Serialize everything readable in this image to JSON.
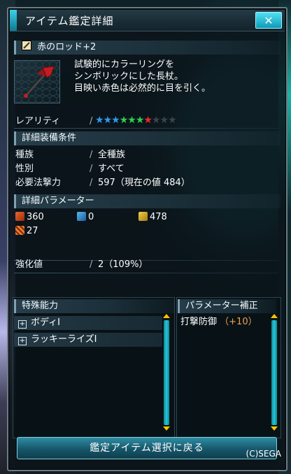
{
  "window": {
    "title": "アイテム鑑定詳細",
    "close_label": "✕"
  },
  "item": {
    "name": "赤のロッド+2",
    "description": "試験的にカラーリングを\nシンボリックにした長杖。\n目映い赤色は必然的に目を引く。"
  },
  "rarity": {
    "label": "レアリティ",
    "max": 10,
    "value": 7
  },
  "requirements": {
    "heading": "詳細装備条件",
    "race_label": "種族",
    "race_value": "全種族",
    "gender_label": "性別",
    "gender_value": "すべて",
    "power_label": "必要法撃力",
    "power_value": "597（現在の値 484）"
  },
  "parameters": {
    "heading": "詳細パラメーター",
    "strike_value": "360",
    "range_value": "0",
    "tech_value": "478",
    "special_value": "27"
  },
  "enhance": {
    "label": "強化値",
    "value": "2（109%）"
  },
  "special_abilities": {
    "heading": "特殊能力",
    "items": [
      {
        "label": "ボディⅠ"
      },
      {
        "label": "ラッキーライズⅠ"
      }
    ]
  },
  "param_correction": {
    "heading": "パラメーター補正",
    "label": "打撃防御",
    "value": "（+10）"
  },
  "footer": {
    "back_button": "鑑定アイテム選択に戻る",
    "copyright": "(C)SEGA"
  },
  "colors": {
    "accent": "#24c6d6",
    "bonus": "#f0a050",
    "scroll_arrow": "#f5c400"
  },
  "icons": {
    "close": "close-icon",
    "item_type": "rod-icon",
    "strike": "strike-icon",
    "range": "range-icon",
    "tech": "tech-icon",
    "special": "special-icon",
    "expand": "plus-icon"
  }
}
